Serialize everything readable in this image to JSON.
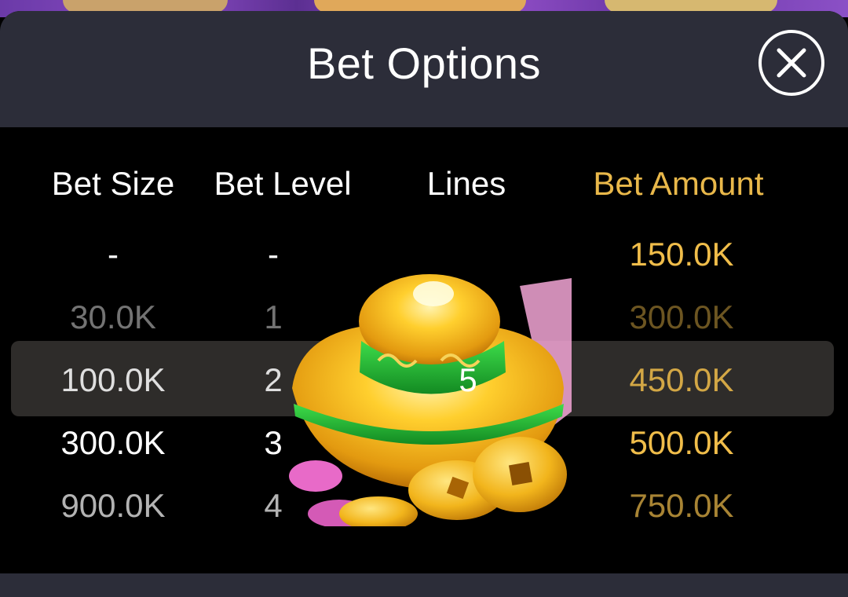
{
  "modal": {
    "title": "Bet Options",
    "close_icon": "close-icon"
  },
  "columns": {
    "bet_size": "Bet Size",
    "bet_level": "Bet Level",
    "lines": "Lines",
    "bet_amount": "Bet Amount"
  },
  "bet_size_values": [
    "-",
    "30.0K",
    "100.0K",
    "300.0K",
    "900.0K"
  ],
  "bet_level_values": [
    "-",
    "1",
    "2",
    "3",
    "4"
  ],
  "lines_value": "5",
  "bet_amount_values": [
    "150.0K",
    "300.0K",
    "450.0K",
    "500.0K",
    "750.0K"
  ],
  "colors": {
    "header_bg": "#2c2d39",
    "accent_gold": "#e9b84a",
    "selection_bar": "#6e6964"
  },
  "icons": {
    "ingot": "gold-ingot-icon",
    "coins": "gold-coins-icon"
  }
}
